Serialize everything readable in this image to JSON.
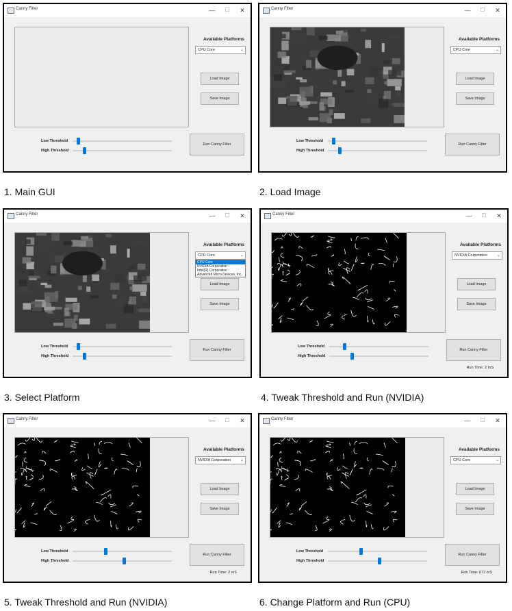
{
  "window_title": "Canny Filter",
  "window_controls": {
    "minimize": "—",
    "maximize": "☐",
    "close": "✕"
  },
  "labels": {
    "available_platforms": "Available Platforms",
    "load_image": "Load Image",
    "save_image": "Save Image",
    "run_canny": "Run Canny Filter",
    "low_threshold": "Low Threshold",
    "high_threshold": "High Threshold"
  },
  "platform_options": [
    "CPU Core",
    "NVIDIA Corporation",
    "Intel(R) Corporation",
    "Advanced Micro Devices, Inc."
  ],
  "panels": [
    {
      "caption": "1. Main GUI",
      "selected_platform": "CPU Core",
      "image": "none",
      "dropdown_open": false,
      "runtime": "",
      "low_threshold": 0.04,
      "high_threshold": 0.11
    },
    {
      "caption": "2. Load Image",
      "selected_platform": "CPU Core",
      "image": "photo",
      "dropdown_open": false,
      "runtime": "",
      "low_threshold": 0.04,
      "high_threshold": 0.11
    },
    {
      "caption": "3. Select Platform",
      "selected_platform": "CPU Core",
      "image": "photo",
      "dropdown_open": true,
      "runtime": "",
      "low_threshold": 0.04,
      "high_threshold": 0.11
    },
    {
      "caption": "4. Tweak Threshold and Run (NVIDIA)",
      "selected_platform": "NVIDIA Corporation",
      "image": "edges",
      "dropdown_open": false,
      "runtime": "Run Time: 2 mS",
      "low_threshold": 0.14,
      "high_threshold": 0.22
    },
    {
      "caption": "5. Tweak Threshold and Run (NVIDIA)",
      "selected_platform": "NVIDIA Corporation",
      "image": "edges",
      "dropdown_open": false,
      "runtime": "Run Time: 2 mS",
      "low_threshold": 0.33,
      "high_threshold": 0.52
    },
    {
      "caption": "6. Change Platform and Run (CPU)",
      "selected_platform": "CPU Core",
      "image": "edges",
      "dropdown_open": false,
      "runtime": "Run Time: 672 mS",
      "low_threshold": 0.33,
      "high_threshold": 0.52
    }
  ]
}
